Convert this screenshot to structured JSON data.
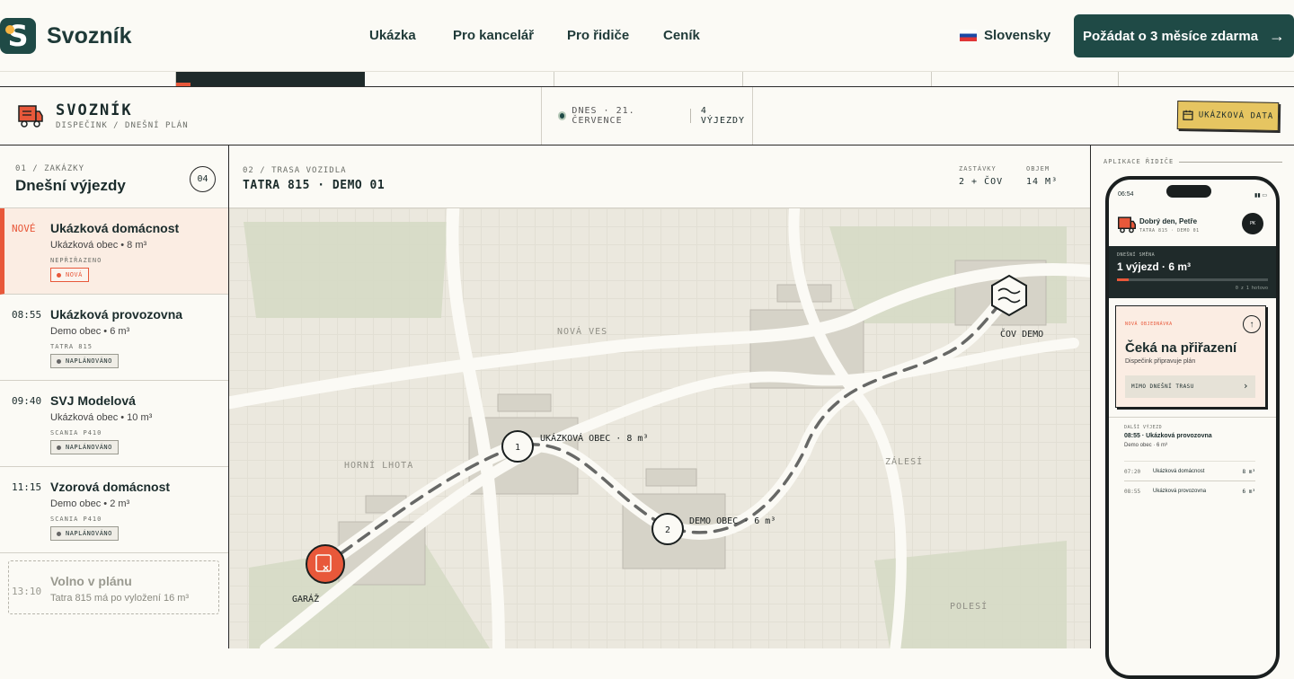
{
  "nav": {
    "logo_letter": "S",
    "brand": "Svozník",
    "links": [
      "Ukázka",
      "Pro kancelář",
      "Pro řidiče",
      "Ceník"
    ],
    "language": "Slovensky",
    "cta": "Požádat o 3 měsíce zdarma",
    "cta_arrow": "→"
  },
  "app": {
    "title": "SVOZNÍK",
    "subtitle": "DISPEČINK / DNEŠNÍ PLÁN",
    "status_date": "DNES · 21. ČERVENCE",
    "status_trips": "4 VÝJEZDY",
    "demo_button": "UKÁZKOVÁ DATA"
  },
  "orders": {
    "kicker": "01 / ZAKÁZKY",
    "title": "Dnešní výjezdy",
    "count": "04",
    "items": [
      {
        "time": "NOVÉ",
        "name": "Ukázková domácnost",
        "meta": "Ukázková obec • 8 m³",
        "vehicle": "NEPŘIŘAZENO",
        "badge": "NOVÁ"
      },
      {
        "time": "08:55",
        "name": "Ukázková provozovna",
        "meta": "Demo obec • 6 m³",
        "vehicle": "TATRA 815",
        "badge": "NAPLÁNOVÁNO"
      },
      {
        "time": "09:40",
        "name": "SVJ Modelová",
        "meta": "Ukázková obec • 10 m³",
        "vehicle": "SCANIA P410",
        "badge": "NAPLÁNOVÁNO"
      },
      {
        "time": "11:15",
        "name": "Vzorová domácnost",
        "meta": "Demo obec • 2 m³",
        "vehicle": "SCANIA P410",
        "badge": "NAPLÁNOVÁNO"
      }
    ],
    "free": {
      "time": "13:10",
      "title": "Volno v plánu",
      "sub": "Tatra 815 má po vyložení 16 m³"
    }
  },
  "route": {
    "kicker": "02 / TRASA VOZIDLA",
    "vehicle": "TATRA 815 · DEMO 01",
    "stops_label": "ZASTÁVKY",
    "stops_value": "2 + ČOV",
    "volume_label": "OBJEM",
    "volume_value": "14 M³",
    "areas": [
      "NOVÁ VES",
      "HORNÍ LHOTA",
      "ZÁLESÍ",
      "POLESÍ"
    ],
    "stop1_number": "1",
    "stop1_label": "UKÁZKOVÁ OBEC · 8 m³",
    "stop2_number": "2",
    "stop2_label": "DEMO OBEC · 6 m³",
    "garage_label": "GARÁŽ",
    "plant_label": "ČOV DEMO"
  },
  "driver_app": {
    "kicker": "APLIKACE ŘIDIČE",
    "time": "06:54",
    "greeting": "Dobrý den, Petře",
    "vehicle": "TATRA 815 · DEMO 01",
    "avatar": "PK",
    "shift_label": "DNEŠNÍ SMĚNA",
    "shift_value": "1 výjezd · 6 m³",
    "shift_progress": 0.08,
    "shift_meta": "0 z 1 hotovo",
    "card_kicker": "NOVÁ OBJEDNÁVKA",
    "card_title": "Čeká na přiřazení",
    "card_sub": "Dispečink připravuje plán",
    "card_button": "MIMO DNEŠNÍ TRASU",
    "next_label": "DALŠÍ VÝJEZD",
    "next_title": "08:55 · Ukázková provozovna",
    "next_sub": "Demo obec · 6 m³",
    "rows": [
      {
        "time": "07:20",
        "name": "Ukázková domácnost",
        "vol": "8 m³"
      },
      {
        "time": "08:55",
        "name": "Ukázková provozovna",
        "vol": "6 m³"
      }
    ]
  },
  "colors": {
    "brand_dark": "#1f4a46",
    "accent": "#e8583a",
    "demo_yellow": "#e6c561"
  }
}
